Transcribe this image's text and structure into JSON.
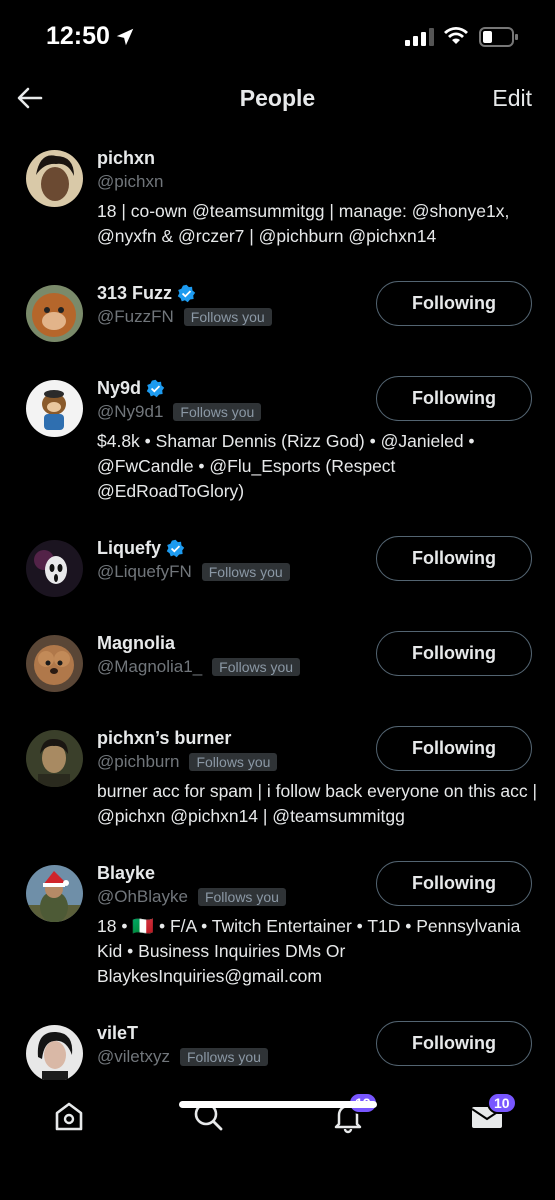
{
  "status_bar": {
    "time": "12:50"
  },
  "header": {
    "title": "People",
    "edit_label": "Edit"
  },
  "follow_button_label": "Following",
  "follows_you_label": "Follows you",
  "users": [
    {
      "name": "pichxn",
      "handle": "@pichxn",
      "verified": false,
      "follows_you": false,
      "has_button": false,
      "bio": "18 | co-own @teamsummitgg | manage: @shonye1x, @nyxfn & @rczer7 | @pichburn @pichxn14"
    },
    {
      "name": "313 Fuzz",
      "handle": "@FuzzFN",
      "verified": true,
      "follows_you": true,
      "has_button": true,
      "bio": ""
    },
    {
      "name": "Ny9d",
      "handle": "@Ny9d1",
      "verified": true,
      "follows_you": true,
      "has_button": true,
      "bio": "$4.8k • Shamar Dennis (Rizz God) • @Janieled • @FwCandle • @Flu_Esports (Respect @EdRoadToGlory)"
    },
    {
      "name": "Liquefy",
      "handle": "@LiquefyFN",
      "verified": true,
      "follows_you": true,
      "has_button": true,
      "bio": ""
    },
    {
      "name": "Magnolia",
      "handle": "@Magnolia1_",
      "verified": false,
      "follows_you": true,
      "has_button": true,
      "bio": ""
    },
    {
      "name": "pichxn’s burner",
      "handle": "@pichburn",
      "verified": false,
      "follows_you": true,
      "has_button": true,
      "bio": "burner acc for spam | i follow back everyone on this acc | @pichxn @pichxn14 | @teamsummitgg"
    },
    {
      "name": "Blayke",
      "handle": "@OhBlayke",
      "verified": false,
      "follows_you": true,
      "has_button": true,
      "bio": "18 • 🇮🇹 • F/A • Twitch Entertainer • T1D • Pennsylvania Kid • Business Inquiries DMs Or BlaykesInquiries@gmail.com"
    },
    {
      "name": "vileT",
      "handle": "@viletxyz",
      "verified": false,
      "follows_you": true,
      "has_button": true,
      "bio": ""
    }
  ],
  "tab_bar": {
    "notifications_badge": "12",
    "messages_badge": "10"
  },
  "colors": {
    "background": "#000000",
    "verified": "#1d9bf0",
    "badge": "#7856ff",
    "muted": "#71767b"
  }
}
